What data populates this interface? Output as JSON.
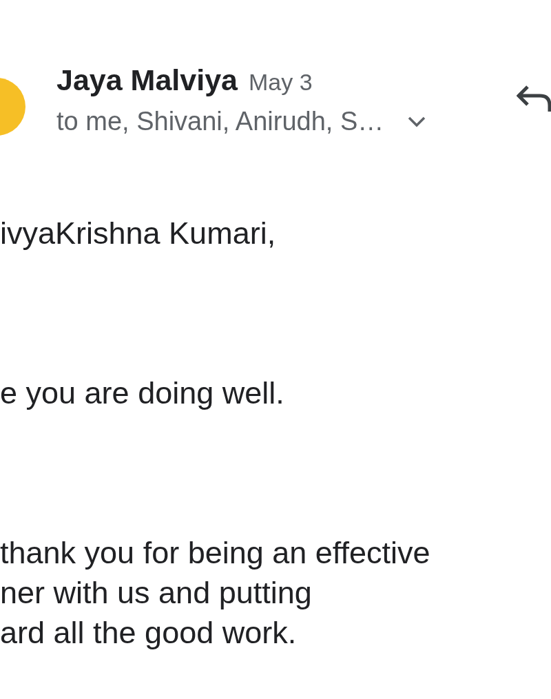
{
  "message": {
    "sender": "Jaya Malviya",
    "date": "May 3",
    "recipients": "to me, Shivani, Anirudh, S…",
    "recipients_expanded": false
  },
  "body": [
    "ivyaKrishna Kumari,",
    "e you are doing well.",
    "thank you for being an effective\nner with us and putting\nard all the good work."
  ]
}
